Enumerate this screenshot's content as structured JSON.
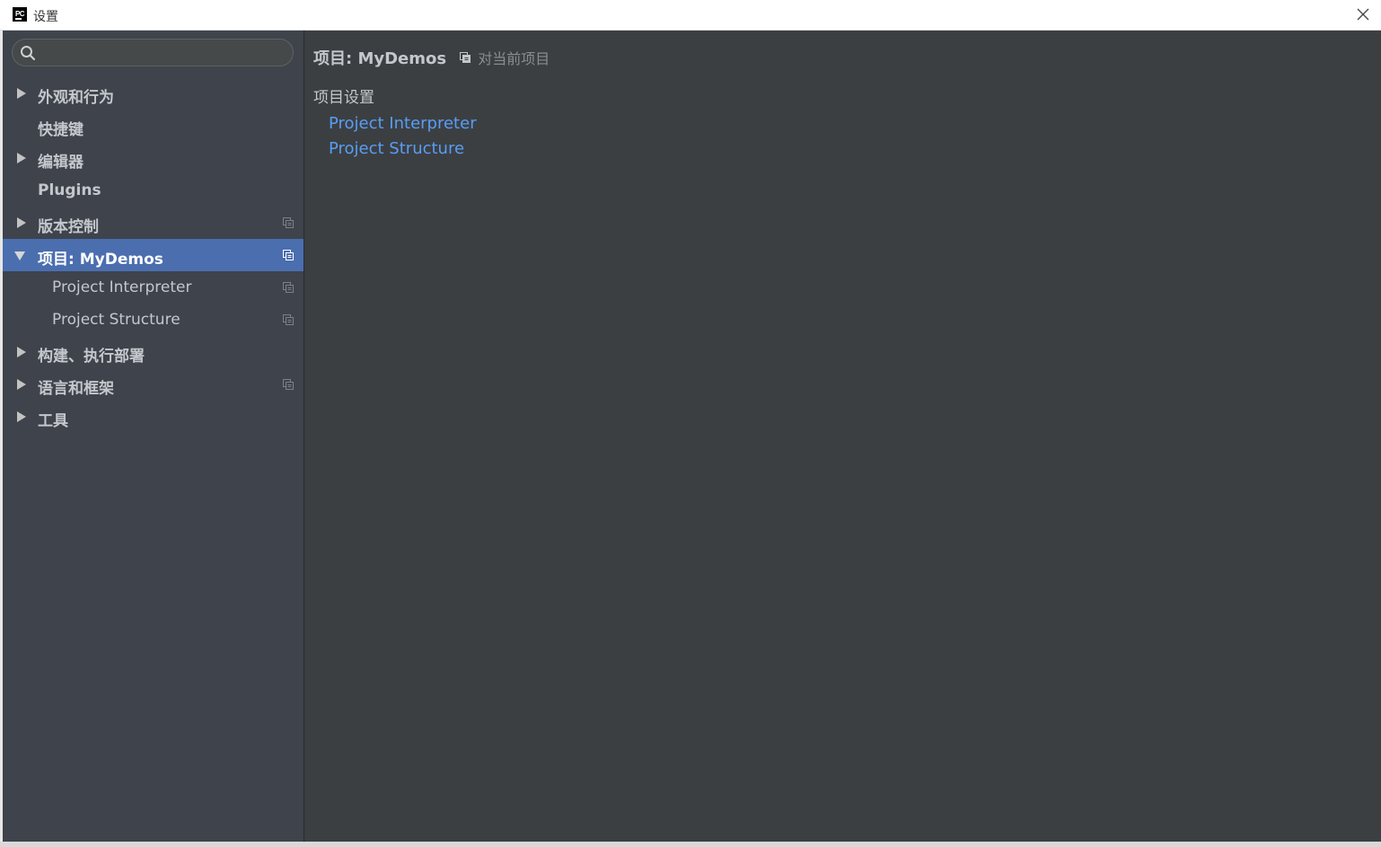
{
  "window": {
    "app_icon_text": "PC",
    "title": "设置"
  },
  "search": {
    "value": "",
    "placeholder": ""
  },
  "sidebar": {
    "items": [
      {
        "label": "外观和行为"
      },
      {
        "label": "快捷键"
      },
      {
        "label": "编辑器"
      },
      {
        "label": "Plugins"
      },
      {
        "label": "版本控制"
      },
      {
        "label": "项目: MyDemos"
      },
      {
        "label": "Project Interpreter"
      },
      {
        "label": "Project Structure"
      },
      {
        "label": "构建、执行部署"
      },
      {
        "label": "语言和框架"
      },
      {
        "label": "工具"
      }
    ]
  },
  "main": {
    "title": "项目: MyDemos",
    "scope": "对当前项目",
    "section_title": "项目设置",
    "links": [
      {
        "label": "Project Interpreter"
      },
      {
        "label": "Project Structure"
      }
    ]
  },
  "colors": {
    "sidebar_bg": "#3e434c",
    "content_bg": "#3c3f41",
    "selected_bg": "#4b6eaf",
    "link": "#589df6"
  }
}
